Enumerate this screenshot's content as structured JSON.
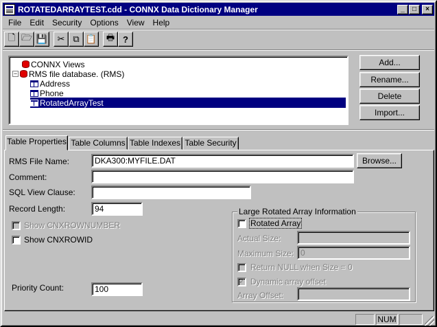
{
  "window": {
    "title": "ROTATEDARRAYTEST.cdd - CONNX Data Dictionary Manager",
    "buttons": {
      "minimize": "_",
      "maximize": "□",
      "close": "×"
    }
  },
  "menu": [
    "File",
    "Edit",
    "Security",
    "Options",
    "View",
    "Help"
  ],
  "toolbar": {
    "icons": [
      "new-document-icon",
      "open-folder-icon",
      "save-disk-icon",
      "cut-scissors-icon",
      "copy-icon",
      "paste-clipboard-icon",
      "print-icon",
      "help-question-icon"
    ],
    "glyphs": [
      "🗋",
      "🗁",
      "💾",
      "✂",
      "⧉",
      "📋",
      "🖶",
      "?"
    ]
  },
  "tree": {
    "items": [
      {
        "label": "CONNX Views",
        "type": "database",
        "level": 0,
        "expanded": false,
        "selected": false
      },
      {
        "label": "RMS file database. (RMS)",
        "type": "database",
        "level": 0,
        "expanded": true,
        "selected": false
      },
      {
        "label": "Address",
        "type": "table",
        "level": 1,
        "selected": false
      },
      {
        "label": "Phone",
        "type": "table",
        "level": 1,
        "selected": false
      },
      {
        "label": "RotatedArrayTest",
        "type": "table",
        "level": 1,
        "selected": true
      }
    ]
  },
  "side_buttons": [
    "Add...",
    "Rename...",
    "Delete",
    "Import..."
  ],
  "tabs": [
    "Table Properties",
    "Table Columns",
    "Table Indexes",
    "Table Security"
  ],
  "active_tab": "Table Properties",
  "form": {
    "rms_file_name": {
      "label": "RMS File Name:",
      "value": "DKA300:MYFILE.DAT"
    },
    "browse_button": "Browse...",
    "comment": {
      "label": "Comment:",
      "value": ""
    },
    "sql_view_clause": {
      "label": "SQL View Clause:",
      "value": ""
    },
    "record_length": {
      "label": "Record Length:",
      "value": "94"
    },
    "show_cnxrownumber": {
      "label": "Show CNXROWNUMBER",
      "checked": false,
      "enabled": false
    },
    "show_cnxrowid": {
      "label": "Show CNXROWID",
      "checked": false,
      "enabled": true
    },
    "priority_count": {
      "label": "Priority Count:",
      "value": "100"
    }
  },
  "rotated_array": {
    "group_title": "Large Rotated Array Information",
    "rotated_array": {
      "label": "Rotated Array",
      "checked": false
    },
    "actual_size": {
      "label": "Actual Size:",
      "value": ""
    },
    "maximum_size": {
      "label": "Maximum Size:",
      "value": "0"
    },
    "return_null": {
      "label": "Return NULL when Size = 0",
      "checked": false
    },
    "dynamic_offset": {
      "label": "Dynamic array offset",
      "checked": true
    },
    "array_offset": {
      "label": "Array Offset:",
      "value": ""
    }
  },
  "status": {
    "num": "NUM"
  }
}
